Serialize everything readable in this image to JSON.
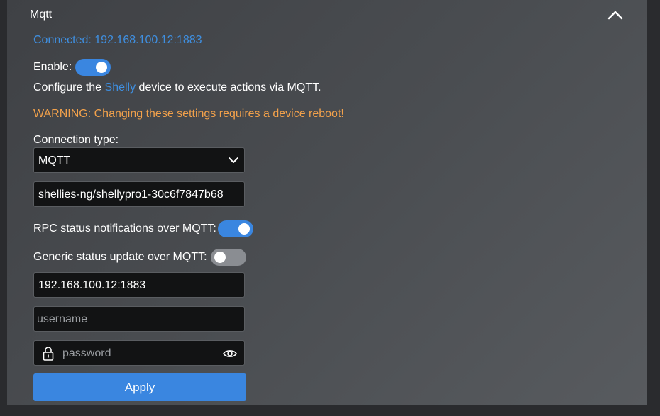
{
  "section": {
    "title": "Mqtt",
    "status": "Connected: 192.168.100.12:1883"
  },
  "enable": {
    "label": "Enable:",
    "on": true
  },
  "info": {
    "prefix": "Configure the ",
    "link": "Shelly",
    "suffix": " device to execute actions via MQTT."
  },
  "warning": "WARNING: Changing these settings requires a device reboot!",
  "connection_type": {
    "label": "Connection type:",
    "selected": "MQTT"
  },
  "client_id": {
    "value": "shellies-ng/shellypro1-30c6f7847b68"
  },
  "rpc_notifications": {
    "label": "RPC status notifications over MQTT:",
    "on": true
  },
  "generic_status": {
    "label": "Generic status update over MQTT:",
    "on": false
  },
  "server": {
    "value": "192.168.100.12:1883"
  },
  "username": {
    "value": "",
    "placeholder": "username"
  },
  "password": {
    "value": "",
    "placeholder": "password"
  },
  "apply_label": "Apply",
  "icons": {
    "collapse": "chevron-up-icon",
    "select_arrow": "chevron-down-icon",
    "lock": "lock-icon",
    "visibility": "eye-icon"
  },
  "colors": {
    "accent": "#3a86e0",
    "link": "#3f8fe0",
    "warning": "#f2a14b"
  }
}
